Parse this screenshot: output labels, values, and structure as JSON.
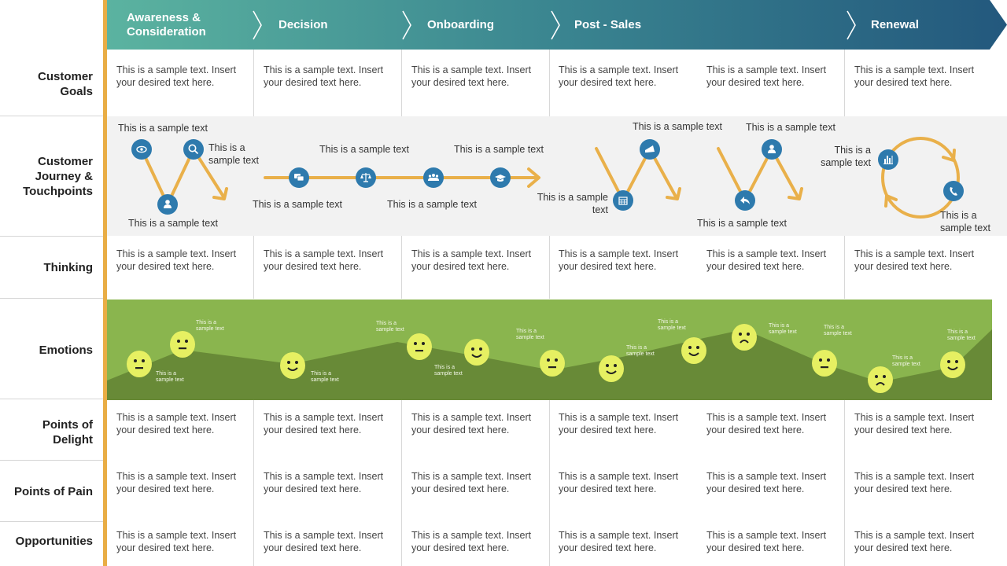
{
  "header": {
    "phases": [
      {
        "label": "Awareness &\nConsideration"
      },
      {
        "label": "Decision"
      },
      {
        "label": "Onboarding"
      },
      {
        "label": "Post - Sales"
      },
      {
        "label": "Renewal"
      }
    ],
    "gradient_start": "#5bb3a0",
    "gradient_end": "#23587d"
  },
  "rows": {
    "customer_goals": {
      "label": "Customer\nGoals"
    },
    "journey": {
      "label": "Customer\nJourney &\nTouchpoints"
    },
    "thinking": {
      "label": "Thinking"
    },
    "emotions": {
      "label": "Emotions"
    },
    "delight": {
      "label": "Points of\nDelight"
    },
    "pain": {
      "label": "Points of Pain"
    },
    "opportunities": {
      "label": "Opportunities"
    }
  },
  "cells": {
    "customer_goals": [
      "This is a sample text. Insert your desired text here.",
      "This is a sample text. Insert your desired text here.",
      "This is a sample text. Insert your desired text here.",
      "This is a sample text. Insert your desired text here.",
      "This is a sample text. Insert your desired text here.",
      "This is a sample text. Insert your desired text here."
    ],
    "thinking": [
      "This is a sample text. Insert your desired text here.",
      "This is a sample text. Insert your desired text here.",
      "This is a sample text. Insert your desired text here.",
      "This is a sample text. Insert your desired text here.",
      "This is a sample text. Insert your desired text here.",
      "This is a sample text. Insert your desired text here."
    ],
    "delight": [
      "This is a sample text. Insert your desired text here.",
      "This is a sample text. Insert your desired text here.",
      "This is a sample text. Insert your desired text here.",
      "This is a sample text. Insert your desired text here.",
      "This is a sample text. Insert your desired text here.",
      "This is a sample text. Insert your desired text here."
    ],
    "pain": [
      "This is a sample text. Insert your desired text here.",
      "This is a sample text. Insert your desired text here.",
      "This is a sample text. Insert your desired text here.",
      "This is a sample text. Insert your desired text here.",
      "This is a sample text. Insert your desired text here.",
      "This is a sample text. Insert your desired text here."
    ],
    "opportunities": [
      "This is a sample text. Insert your desired text here.",
      "This is a sample text. Insert your desired text here.",
      "This is a sample text. Insert your desired text here.",
      "This is a sample text. Insert your desired text here.",
      "This is a sample text. Insert your desired text here.",
      "This is a sample text. Insert your desired text here."
    ]
  },
  "journey": {
    "touchpoints": [
      {
        "icon": "eye-icon",
        "label": "This is a sample text"
      },
      {
        "icon": "user-icon",
        "label": "This is a sample text"
      },
      {
        "icon": "search-icon",
        "label": "This is a\nsample text"
      },
      {
        "icon": "chat-icon",
        "label": "This is a sample text"
      },
      {
        "icon": "scales-icon",
        "label": "This is a sample text"
      },
      {
        "icon": "group-icon",
        "label": "This is a sample text"
      },
      {
        "icon": "graduation-cap-icon",
        "label": "This is a sample text"
      },
      {
        "icon": "calendar-icon",
        "label": "This is a sample\ntext"
      },
      {
        "icon": "megaphone-icon",
        "label": "This is a sample text"
      },
      {
        "icon": "reply-icon",
        "label": "This is a sample text"
      },
      {
        "icon": "user-icon",
        "label": "This is a sample text"
      },
      {
        "icon": "chart-icon",
        "label": "This is a\nsample text"
      },
      {
        "icon": "phone-icon",
        "label": "This is a\nsample text"
      }
    ],
    "icon_color": "#2e7aad",
    "path_color": "#e9b04a"
  },
  "emotions": {
    "light_green": "#8ab54e",
    "dark_green": "#688a37",
    "face_color": "#e6f062",
    "points": [
      {
        "mood": "neutral",
        "label": "This is a\nsample text"
      },
      {
        "mood": "neutral",
        "label": "This is a\nsample text"
      },
      {
        "mood": "happy",
        "label": "This is a\nsample text"
      },
      {
        "mood": "neutral",
        "label": "This is a\nsample text"
      },
      {
        "mood": "happy",
        "label": "This is a\nsample text"
      },
      {
        "mood": "neutral",
        "label": "This is a\nsample text"
      },
      {
        "mood": "happy",
        "label": "This is a\nsample text"
      },
      {
        "mood": "happy",
        "label": "This is a\nsample text"
      },
      {
        "mood": "sad",
        "label": "This is a\nsample text"
      },
      {
        "mood": "neutral",
        "label": "This is a\nsample text"
      },
      {
        "mood": "sad",
        "label": "This is a\nsample text"
      },
      {
        "mood": "happy",
        "label": "This is a\nsample text"
      }
    ]
  }
}
